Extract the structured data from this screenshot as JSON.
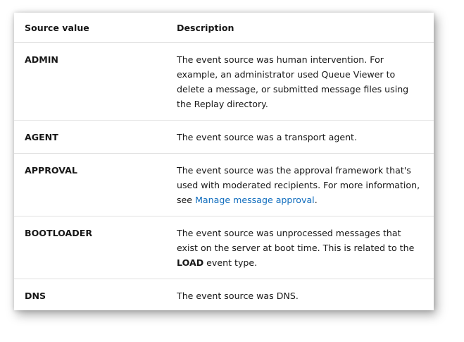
{
  "table": {
    "headers": [
      "Source value",
      "Description"
    ],
    "rows": [
      {
        "source": "ADMIN",
        "description": "The event source was human intervention. For example, an administrator used Queue Viewer to delete a message, or submitted message files using the Replay directory."
      },
      {
        "source": "AGENT",
        "description": "The event source was a transport agent."
      },
      {
        "source": "APPROVAL",
        "description_before": "The event source was the approval framework that's used with moderated recipients. For more information, see ",
        "link_text": "Manage message approval",
        "description_after": "."
      },
      {
        "source": "BOOTLOADER",
        "description_before": "The event source was unprocessed messages that exist on the server at boot time. This is related to the ",
        "bold_text": "LOAD",
        "description_after": " event type."
      },
      {
        "source": "DNS",
        "description": "The event source was DNS."
      }
    ]
  },
  "colors": {
    "link": "#0f6cbd",
    "text": "#171717",
    "divider": "#e1e1e1"
  }
}
